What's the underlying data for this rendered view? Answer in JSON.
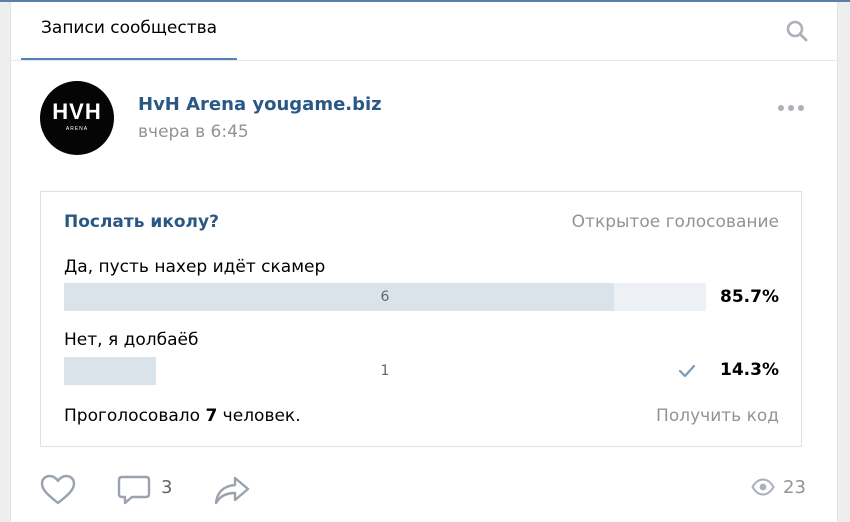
{
  "header": {
    "tab_label": "Записи сообщества"
  },
  "post": {
    "author": "HvH Arena yougame.biz",
    "date": "вчера в 6:45",
    "avatar": {
      "logo_text": "HVH",
      "logo_sub": "ARENA"
    }
  },
  "poll": {
    "question": "Послать иколу?",
    "type": "Открытое голосование",
    "answers": [
      {
        "label": "Да, пусть нахер идёт скамер",
        "count": "6",
        "percent": "85.7%",
        "fraction": 0.857,
        "voted": false
      },
      {
        "label": "Нет, я долбаёб",
        "count": "1",
        "percent": "14.3%",
        "fraction": 0.143,
        "voted": true
      }
    ],
    "voted_prefix": "Проголосовало ",
    "voted_count": "7",
    "voted_suffix": " человек.",
    "get_code": "Получить код"
  },
  "actions": {
    "comments": "3",
    "views": "23"
  },
  "colors": {
    "link": "#2a5885",
    "accent": "#5181b8",
    "bar_fill": "#dae2ea",
    "muted": "#939393"
  }
}
